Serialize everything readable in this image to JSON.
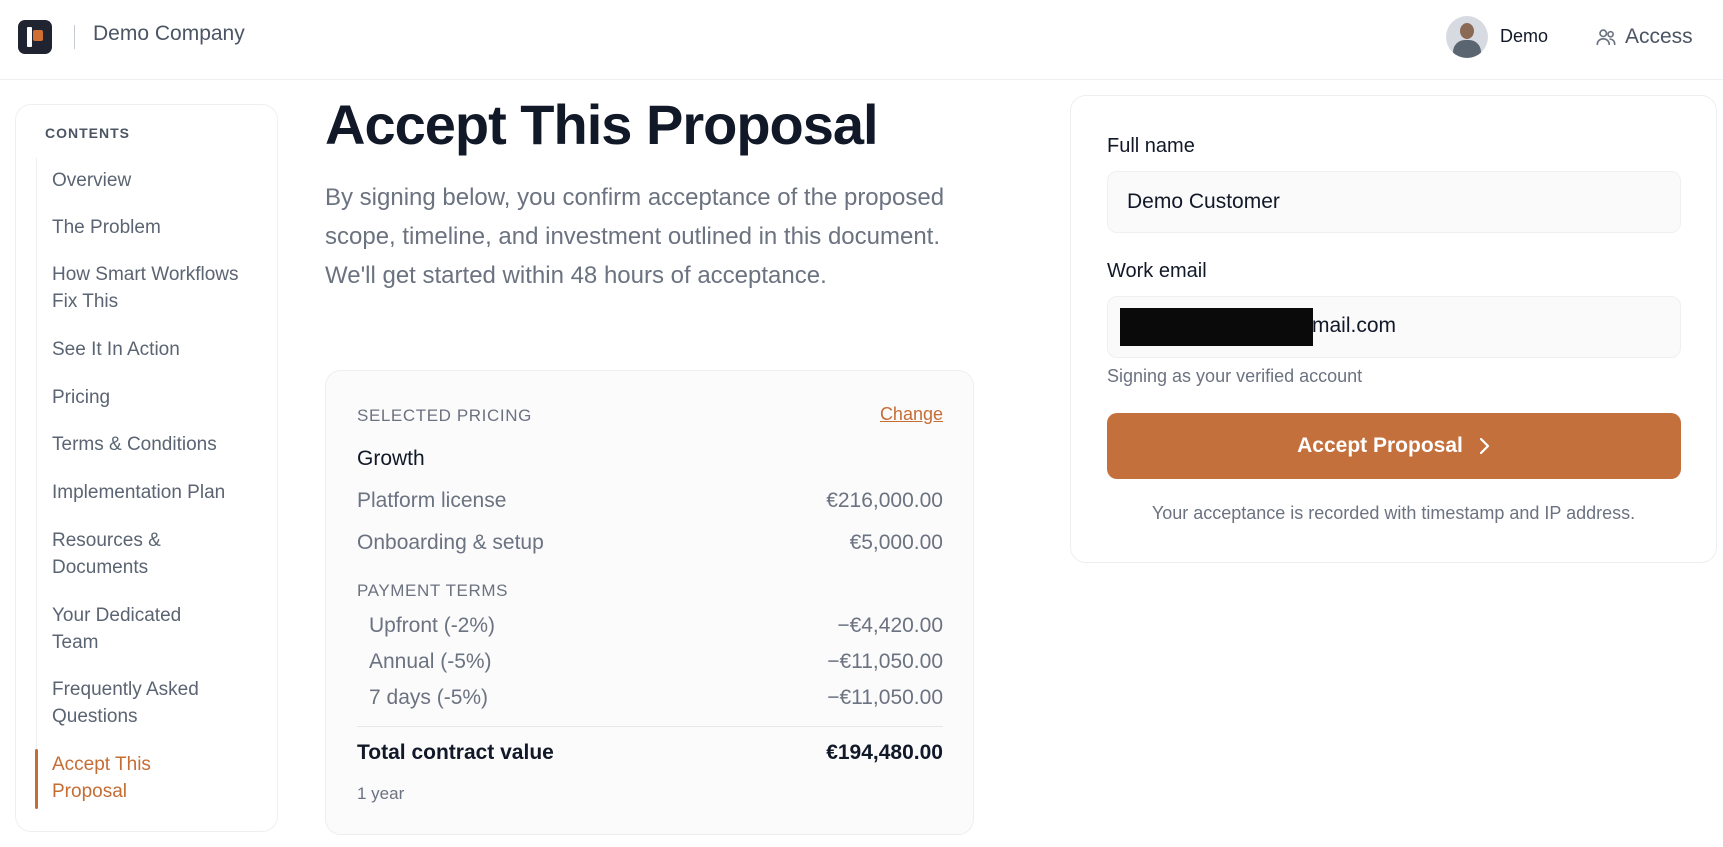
{
  "header": {
    "company_name": "Demo Company",
    "user_name": "Demo",
    "access_label": "Access",
    "icons": {
      "logo": "brand-logo",
      "avatar": "user-avatar",
      "access": "users-icon"
    }
  },
  "sidebar": {
    "title": "CONTENTS",
    "items": [
      {
        "label": "Overview",
        "active": false
      },
      {
        "label": "The Problem",
        "active": false
      },
      {
        "label": "How Smart Workflows Fix This",
        "active": false
      },
      {
        "label": "See It In Action",
        "active": false
      },
      {
        "label": "Pricing",
        "active": false
      },
      {
        "label": "Terms & Conditions",
        "active": false
      },
      {
        "label": "Implementation Plan",
        "active": false
      },
      {
        "label": "Resources & Documents",
        "active": false
      },
      {
        "label": "Your Dedicated Team",
        "active": false
      },
      {
        "label": "Frequently Asked Questions",
        "active": false
      },
      {
        "label": "Accept This Proposal",
        "active": true
      }
    ]
  },
  "main": {
    "title": "Accept This Proposal",
    "intro": "By signing below, you confirm acceptance of the proposed scope, timeline, and investment outlined in this document. We'll get started within 48 hours of acceptance."
  },
  "pricing": {
    "section_label": "SELECTED PRICING",
    "change_label": "Change",
    "plan_name": "Growth",
    "lines": [
      {
        "label": "Platform license",
        "amount": "€216,000.00"
      },
      {
        "label": "Onboarding & setup",
        "amount": "€5,000.00"
      }
    ],
    "terms_label": "PAYMENT TERMS",
    "terms": [
      {
        "label": "Upfront (-2%)",
        "amount": "−€4,420.00"
      },
      {
        "label": "Annual (-5%)",
        "amount": "−€11,050.00"
      },
      {
        "label": "7 days (-5%)",
        "amount": "−€11,050.00"
      }
    ],
    "total_label": "Total contract value",
    "total_amount": "€194,480.00",
    "term_length": "1 year"
  },
  "form": {
    "name_label": "Full name",
    "name_value": "Demo Customer",
    "email_label": "Work email",
    "email_value_visible": "mail.com",
    "email_hint": "Signing as your verified account",
    "accept_label": "Accept Proposal",
    "footnote": "Your acceptance is recorded with timestamp and IP address.",
    "accent_color": "#c4703d"
  }
}
